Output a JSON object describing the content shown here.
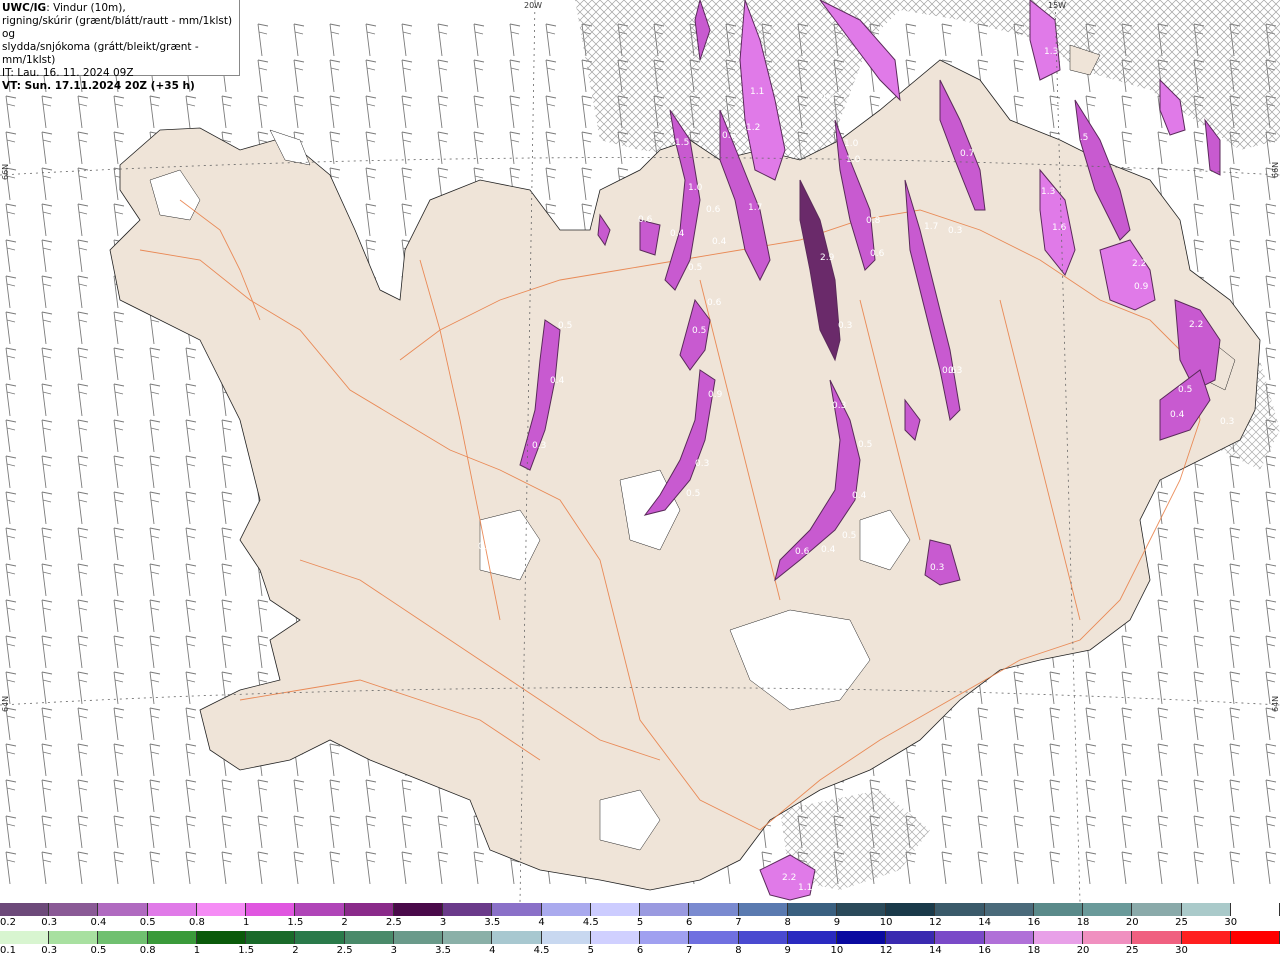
{
  "header": {
    "model": "UWC/IG",
    "desc_line1": ": Vindur (10m),",
    "desc_line2": "rigning/skúrir (grænt/blátt/rautt - mm/1klst) og",
    "desc_line3": "slydda/snjókoma (grátt/bleikt/grænt - mm/1klst)",
    "it_line": "IT: Lau. 16. 11. 2024 09Z",
    "vt_line": "VT: Sun. 17.11.2024 20Z (+35 h)"
  },
  "graticule_labels": {
    "top1": "20W",
    "top2": "15W",
    "left1": "66N",
    "left2": "64N",
    "right1": "66N",
    "right2": "64N"
  },
  "precip_labels": [
    "1.5",
    "1.0",
    "0.6",
    "0.6",
    "0.4",
    "0.5",
    "0.6",
    "0.5",
    "0.9",
    "0.3",
    "0.5",
    "1.1",
    "0.8",
    "1.2",
    "1.7",
    "0.4",
    "0.6",
    "0.8",
    "2.9",
    "0.5",
    "0.6",
    "0.8",
    "1.0",
    "0.7",
    "0.3",
    "1.3",
    "0.6",
    "0.3",
    "0.3",
    "0.3",
    "0.5",
    "0.4",
    "0.4",
    "0.5",
    "0.6",
    "0.3",
    "1.6",
    "1.3",
    "1.5",
    "2.2",
    "0.9",
    "2.2",
    "0.5",
    "0.4",
    "0.3",
    "2.2",
    "1.1",
    "0.3",
    "0.3",
    "1.7",
    "0.4",
    "1.0"
  ],
  "legend_snow": {
    "values": [
      "0.2",
      "0.3",
      "0.4",
      "0.5",
      "0.8",
      "1",
      "1.5",
      "2",
      "2.5",
      "3",
      "3.5",
      "4",
      "4.5",
      "5",
      "6",
      "7",
      "8",
      "9",
      "10",
      "12",
      "14",
      "16",
      "18",
      "20",
      "25",
      "30"
    ],
    "colors": [
      "#6d4a7a",
      "#8a5a96",
      "#b06ac0",
      "#e07ae8",
      "#f58cf5",
      "#e056e0",
      "#b045b8",
      "#8a2a8a",
      "#4a0a4a",
      "#6a3a8a",
      "#8a70c8",
      "#aaaaee",
      "#ccccff",
      "#9a9ae0",
      "#7a8ad0",
      "#5a7ab0",
      "#3a6080",
      "#2a4a5a",
      "#1a3a4a",
      "#3a5a6a",
      "#4a6a7a",
      "#5a8a8a",
      "#6a9a9a",
      "#8aaaaa",
      "#aacaca",
      "#ffffff"
    ]
  },
  "legend_rain": {
    "values": [
      "0.1",
      "0.3",
      "0.5",
      "0.8",
      "1",
      "1.5",
      "2",
      "2.5",
      "3",
      "3.5",
      "4",
      "4.5",
      "5",
      "6",
      "7",
      "8",
      "9",
      "10",
      "12",
      "14",
      "16",
      "18",
      "20",
      "25",
      "30"
    ],
    "colors": [
      "#d8f5d0",
      "#a8e0a0",
      "#70c070",
      "#3a9a3a",
      "#0a5a0a",
      "#1a6a2a",
      "#2a7a4a",
      "#4a8a6a",
      "#6a9a8a",
      "#8ab0a8",
      "#a8c8d0",
      "#c8d8f0",
      "#d0d0ff",
      "#a0a0f0",
      "#7070e0",
      "#4a4ad0",
      "#2a2ac0",
      "#0a0aa0",
      "#3a2ab0",
      "#7a4ac8",
      "#b070d8",
      "#e8a0e8",
      "#f090c0",
      "#f06080",
      "#ff2020",
      "#ff0000"
    ]
  }
}
